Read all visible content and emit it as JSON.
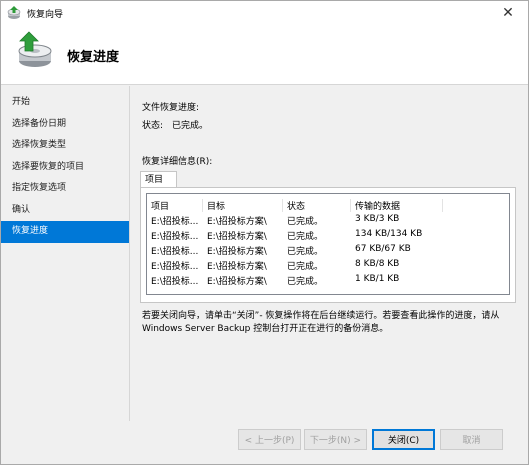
{
  "window": {
    "title": "恢复向导",
    "close_glyph": "✕"
  },
  "header": {
    "title": "恢复进度"
  },
  "sidebar": {
    "items": [
      {
        "label": "开始"
      },
      {
        "label": "选择备份日期"
      },
      {
        "label": "选择恢复类型"
      },
      {
        "label": "选择要恢复的项目"
      },
      {
        "label": "指定恢复选项"
      },
      {
        "label": "确认"
      },
      {
        "label": "恢复进度",
        "active": true
      }
    ]
  },
  "main": {
    "file_progress_label": "文件恢复进度:",
    "status_label": "状态:",
    "status_value": "已完成。",
    "details_label": "恢复详细信息(R):",
    "tab_label": "项目",
    "columns": [
      "项目",
      "目标",
      "状态",
      "传输的数据"
    ],
    "rows": [
      {
        "item": "E:\\招投标...",
        "target": "E:\\招投标方案\\",
        "status": "已完成。",
        "data": "3 KB/3 KB"
      },
      {
        "item": "E:\\招投标...",
        "target": "E:\\招投标方案\\",
        "status": "已完成。",
        "data": "134 KB/134 KB"
      },
      {
        "item": "E:\\招投标...",
        "target": "E:\\招投标方案\\",
        "status": "已完成。",
        "data": "67 KB/67 KB"
      },
      {
        "item": "E:\\招投标...",
        "target": "E:\\招投标方案\\",
        "status": "已完成。",
        "data": "8 KB/8 KB"
      },
      {
        "item": "E:\\招投标...",
        "target": "E:\\招投标方案\\",
        "status": "已完成。",
        "data": "1 KB/1 KB"
      }
    ],
    "note_line1": "若要关闭向导，请单击“关闭”- 恢复操作将在后台继续运行。若要查看此操作的进度，请从",
    "note_line2": "Windows Server Backup 控制台打开正在进行的备份消息。"
  },
  "footer": {
    "back_label": "< 上一步(P)",
    "next_label": "下一步(N) >",
    "close_label": "关闭(C)",
    "cancel_label": "取消"
  },
  "colors": {
    "selection": "#0078d7",
    "disabled_text": "#a0a0a0"
  },
  "icons": {
    "app": "backup-restore-icon",
    "header": "backup-restore-large-icon"
  }
}
